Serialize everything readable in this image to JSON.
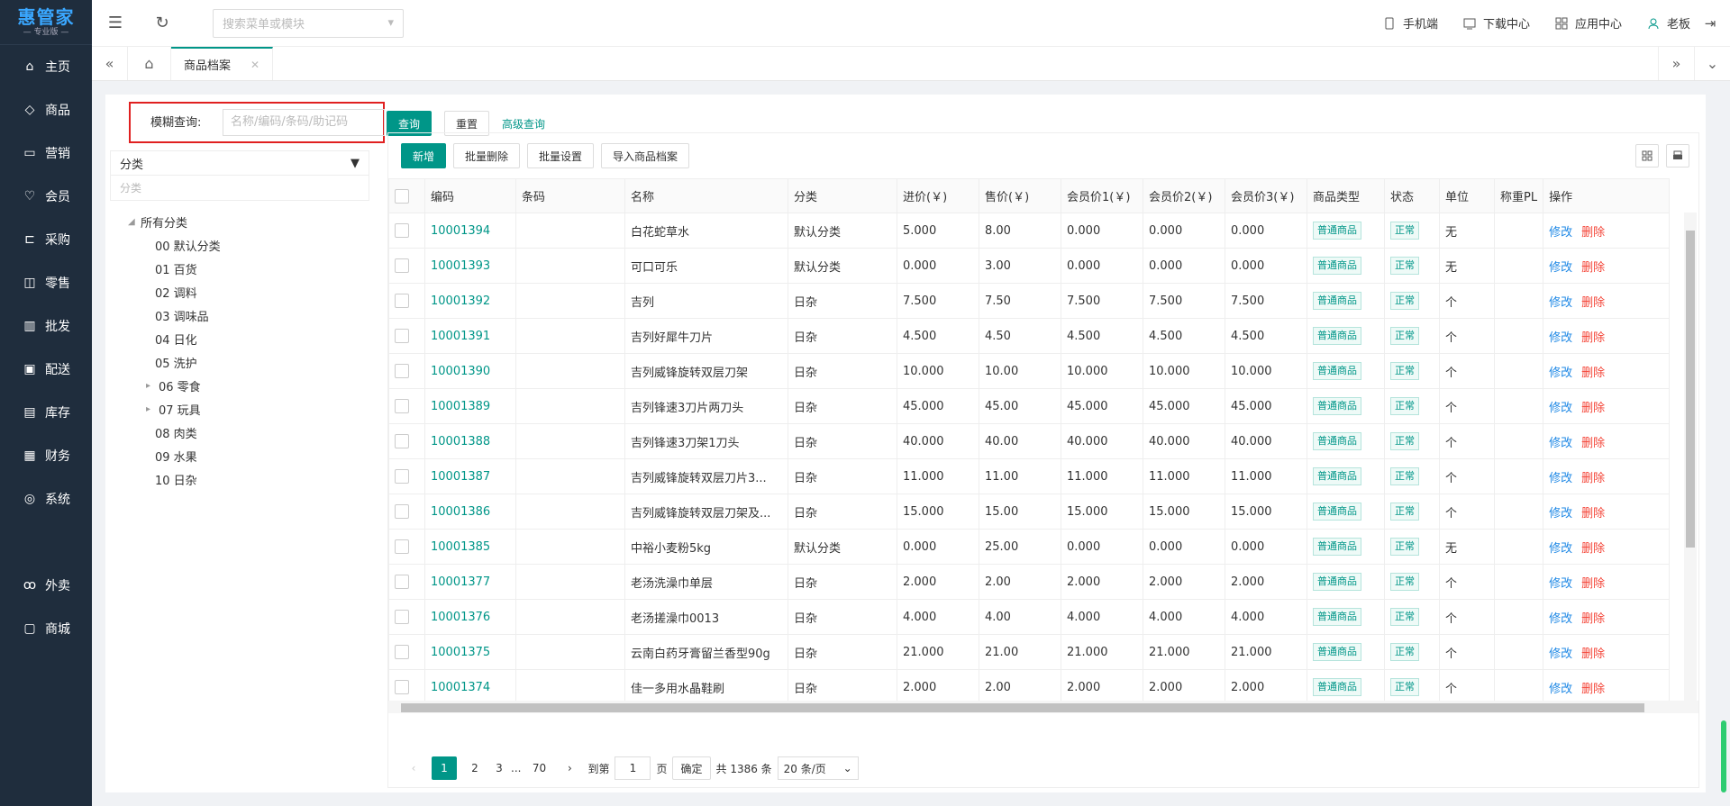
{
  "app": {
    "logo_main": "惠管家",
    "logo_sub": "— 专业版 —"
  },
  "sidebar": {
    "items": [
      {
        "label": "主页",
        "icon": "home-icon"
      },
      {
        "label": "商品",
        "icon": "box-icon"
      },
      {
        "label": "营销",
        "icon": "marketing-icon"
      },
      {
        "label": "会员",
        "icon": "member-icon"
      },
      {
        "label": "采购",
        "icon": "cart-icon"
      },
      {
        "label": "零售",
        "icon": "bag-icon"
      },
      {
        "label": "批发",
        "icon": "wholesale-icon"
      },
      {
        "label": "配送",
        "icon": "delivery-icon"
      },
      {
        "label": "库存",
        "icon": "inventory-icon"
      },
      {
        "label": "财务",
        "icon": "finance-icon"
      },
      {
        "label": "系统",
        "icon": "system-icon"
      }
    ],
    "extra_items": [
      {
        "label": "外卖",
        "icon": "takeout-icon"
      },
      {
        "label": "商城",
        "icon": "mall-icon"
      }
    ]
  },
  "topbar": {
    "search_placeholder": "搜索菜单或模块",
    "mobile": "手机端",
    "download": "下载中心",
    "apps": "应用中心",
    "user": "老板"
  },
  "tabs": {
    "items": [
      {
        "label": "商品档案"
      }
    ]
  },
  "query": {
    "label": "模糊查询:",
    "placeholder": "名称/编码/条码/助记码",
    "search_btn": "查询",
    "reset_btn": "重置",
    "advanced": "高级查询"
  },
  "category": {
    "select_label": "分类",
    "input_placeholder": "分类",
    "root": "所有分类",
    "children": [
      {
        "label": "00 默认分类",
        "expandable": false
      },
      {
        "label": "01 百货",
        "expandable": false
      },
      {
        "label": "02 调料",
        "expandable": false
      },
      {
        "label": "03 调味品",
        "expandable": false
      },
      {
        "label": "04 日化",
        "expandable": false
      },
      {
        "label": "05 洗护",
        "expandable": false
      },
      {
        "label": "06 零食",
        "expandable": true
      },
      {
        "label": "07 玩具",
        "expandable": true
      },
      {
        "label": "08 肉类",
        "expandable": false
      },
      {
        "label": "09 水果",
        "expandable": false
      },
      {
        "label": "10 日杂",
        "expandable": false
      }
    ]
  },
  "toolbar": {
    "add": "新增",
    "batch_delete": "批量删除",
    "batch_set": "批量设置",
    "import": "导入商品档案"
  },
  "table": {
    "headers": [
      "编码",
      "条码",
      "名称",
      "分类",
      "进价(￥)",
      "售价(￥)",
      "会员价1(￥)",
      "会员价2(￥)",
      "会员价3(￥)",
      "商品类型",
      "状态",
      "单位",
      "称重PL",
      "操作"
    ],
    "edit_label": "修改",
    "delete_label": "删除",
    "rows": [
      {
        "code": "10001394",
        "barcode": "",
        "name": "白花蛇草水",
        "cat": "默认分类",
        "cost": "5.000",
        "price": "8.00",
        "m1": "0.000",
        "m2": "0.000",
        "m3": "0.000",
        "type": "普通商品",
        "status": "正常",
        "unit": "无"
      },
      {
        "code": "10001393",
        "barcode": "",
        "name": "可口可乐",
        "cat": "默认分类",
        "cost": "0.000",
        "price": "3.00",
        "m1": "0.000",
        "m2": "0.000",
        "m3": "0.000",
        "type": "普通商品",
        "status": "正常",
        "unit": "无"
      },
      {
        "code": "10001392",
        "barcode": "",
        "name": "吉列",
        "cat": "日杂",
        "cost": "7.500",
        "price": "7.50",
        "m1": "7.500",
        "m2": "7.500",
        "m3": "7.500",
        "type": "普通商品",
        "status": "正常",
        "unit": "个"
      },
      {
        "code": "10001391",
        "barcode": "",
        "name": "吉列好犀牛刀片",
        "cat": "日杂",
        "cost": "4.500",
        "price": "4.50",
        "m1": "4.500",
        "m2": "4.500",
        "m3": "4.500",
        "type": "普通商品",
        "status": "正常",
        "unit": "个"
      },
      {
        "code": "10001390",
        "barcode": "",
        "name": "吉列威锋旋转双层刀架",
        "cat": "日杂",
        "cost": "10.000",
        "price": "10.00",
        "m1": "10.000",
        "m2": "10.000",
        "m3": "10.000",
        "type": "普通商品",
        "status": "正常",
        "unit": "个"
      },
      {
        "code": "10001389",
        "barcode": "",
        "name": "吉列锋速3刀片两刀头",
        "cat": "日杂",
        "cost": "45.000",
        "price": "45.00",
        "m1": "45.000",
        "m2": "45.000",
        "m3": "45.000",
        "type": "普通商品",
        "status": "正常",
        "unit": "个"
      },
      {
        "code": "10001388",
        "barcode": "",
        "name": "吉列锋速3刀架1刀头",
        "cat": "日杂",
        "cost": "40.000",
        "price": "40.00",
        "m1": "40.000",
        "m2": "40.000",
        "m3": "40.000",
        "type": "普通商品",
        "status": "正常",
        "unit": "个"
      },
      {
        "code": "10001387",
        "barcode": "",
        "name": "吉列威锋旋转双层刀片3...",
        "cat": "日杂",
        "cost": "11.000",
        "price": "11.00",
        "m1": "11.000",
        "m2": "11.000",
        "m3": "11.000",
        "type": "普通商品",
        "status": "正常",
        "unit": "个"
      },
      {
        "code": "10001386",
        "barcode": "",
        "name": "吉列威锋旋转双层刀架及...",
        "cat": "日杂",
        "cost": "15.000",
        "price": "15.00",
        "m1": "15.000",
        "m2": "15.000",
        "m3": "15.000",
        "type": "普通商品",
        "status": "正常",
        "unit": "个"
      },
      {
        "code": "10001385",
        "barcode": "",
        "name": "中裕小麦粉5kg",
        "cat": "默认分类",
        "cost": "0.000",
        "price": "25.00",
        "m1": "0.000",
        "m2": "0.000",
        "m3": "0.000",
        "type": "普通商品",
        "status": "正常",
        "unit": "无"
      },
      {
        "code": "10001377",
        "barcode": "",
        "name": "老汤洗澡巾单层",
        "cat": "日杂",
        "cost": "2.000",
        "price": "2.00",
        "m1": "2.000",
        "m2": "2.000",
        "m3": "2.000",
        "type": "普通商品",
        "status": "正常",
        "unit": "个"
      },
      {
        "code": "10001376",
        "barcode": "",
        "name": "老汤搓澡巾0013",
        "cat": "日杂",
        "cost": "4.000",
        "price": "4.00",
        "m1": "4.000",
        "m2": "4.000",
        "m3": "4.000",
        "type": "普通商品",
        "status": "正常",
        "unit": "个"
      },
      {
        "code": "10001375",
        "barcode": "",
        "name": "云南白药牙膏留兰香型90g",
        "cat": "日杂",
        "cost": "21.000",
        "price": "21.00",
        "m1": "21.000",
        "m2": "21.000",
        "m3": "21.000",
        "type": "普通商品",
        "status": "正常",
        "unit": "个"
      },
      {
        "code": "10001374",
        "barcode": "",
        "name": "佳一多用水晶鞋刷",
        "cat": "日杂",
        "cost": "2.000",
        "price": "2.00",
        "m1": "2.000",
        "m2": "2.000",
        "m3": "2.000",
        "type": "普通商品",
        "status": "正常",
        "unit": "个"
      }
    ]
  },
  "pager": {
    "pages": [
      "1",
      "2",
      "3"
    ],
    "ellipsis": "...",
    "last": "70",
    "goto_label": "到第",
    "goto_value": "1",
    "page_unit": "页",
    "confirm": "确定",
    "total": "共 1386 条",
    "page_size": "20 条/页"
  }
}
